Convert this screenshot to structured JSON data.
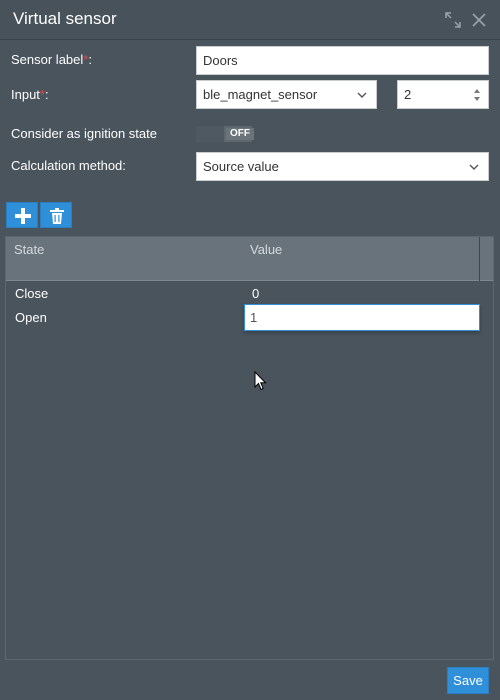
{
  "window": {
    "title": "Virtual sensor",
    "icons": {
      "expand": "expand-icon",
      "close": "close-icon"
    }
  },
  "form": {
    "sensor_label": {
      "label": "Sensor label",
      "required_mark": "*",
      "suffix": ":",
      "value": "Doors"
    },
    "input": {
      "label": "Input",
      "required_mark": "*",
      "suffix": ":",
      "selected": "ble_magnet_sensor",
      "number": "2"
    },
    "ignition": {
      "label": "Consider as ignition state",
      "toggle_text": "OFF",
      "state": "off"
    },
    "calculation": {
      "label": "Calculation method:",
      "selected": "Source value"
    }
  },
  "toolbar": {
    "add_icon": "plus-icon",
    "delete_icon": "trash-icon"
  },
  "table": {
    "columns": [
      "State",
      "Value"
    ],
    "rows": [
      {
        "state": "Close",
        "value": "0"
      },
      {
        "state": "Open",
        "value": "1"
      }
    ]
  },
  "footer": {
    "save_label": "Save"
  },
  "colors": {
    "accent": "#2f8fd9",
    "background": "#4a545d",
    "header": "#68737c",
    "required": "#e04848"
  }
}
